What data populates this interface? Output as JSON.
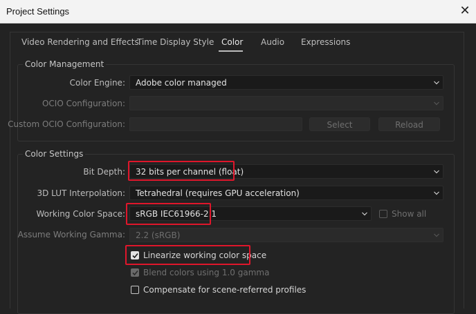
{
  "window": {
    "title": "Project Settings",
    "close_glyph": "✕"
  },
  "tabs": [
    {
      "label": "Video Rendering and Effects"
    },
    {
      "label": "Time Display Style"
    },
    {
      "label": "Color"
    },
    {
      "label": "Audio"
    },
    {
      "label": "Expressions"
    }
  ],
  "active_tab": "Color",
  "color_management": {
    "title": "Color Management",
    "color_engine": {
      "label": "Color Engine:",
      "value": "Adobe color managed"
    },
    "ocio_configuration": {
      "label": "OCIO Configuration:",
      "value": ""
    },
    "custom_ocio": {
      "label": "Custom OCIO Configuration:",
      "value": "",
      "select_label": "Select",
      "reload_label": "Reload"
    }
  },
  "color_settings": {
    "title": "Color Settings",
    "bit_depth": {
      "label": "Bit Depth:",
      "value": "32 bits per channel (float)"
    },
    "lut_interpolation": {
      "label": "3D LUT Interpolation:",
      "value": "Tetrahedral (requires GPU acceleration)"
    },
    "working_color_space": {
      "label": "Working Color Space:",
      "value": "sRGB IEC61966-2.1",
      "show_all_label": "Show all",
      "show_all_checked": false
    },
    "assume_gamma": {
      "label": "Assume Working Gamma:",
      "value": "2.2 (sRGB)"
    },
    "linearize": {
      "label": "Linearize working color space",
      "checked": true
    },
    "blend_gamma": {
      "label": "Blend colors using 1.0 gamma",
      "checked": true,
      "disabled": true
    },
    "compensate": {
      "label": "Compensate for scene-referred profiles",
      "checked": false
    }
  },
  "colors": {
    "highlight": "#e0162b",
    "background": "#232323",
    "titlebar": "#f3f3f3"
  }
}
